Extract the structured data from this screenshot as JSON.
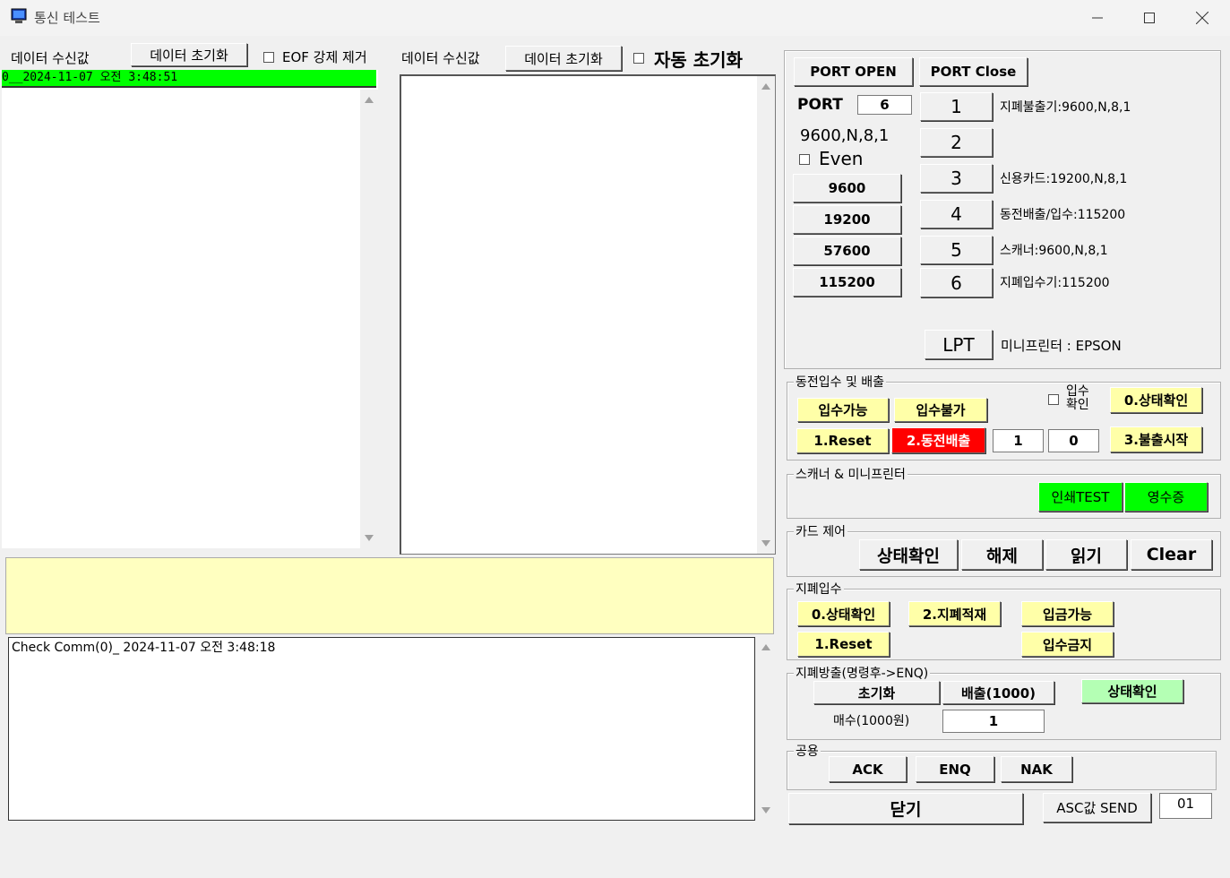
{
  "window": {
    "title": "통신 테스트",
    "minimize_icon": "minimize-icon",
    "maximize_icon": "maximize-icon",
    "close_icon": "close-icon"
  },
  "left_panel": {
    "label": "데이터 수신값",
    "reset_button": "데이터 초기화",
    "eof_label": "EOF 강제 제거",
    "eof_checked": false,
    "selected_item": "0__2024-11-07 오전 3:48:51"
  },
  "middle_panel": {
    "label": "데이터 수신값",
    "reset_button": "데이터 초기화",
    "auto_reset_label": "자동 초기화",
    "auto_reset_checked": false
  },
  "log_box": {
    "line": "Check Comm(0)_ 2024-11-07 오전 3:48:18"
  },
  "port": {
    "open_button": "PORT OPEN",
    "close_button": "PORT Close",
    "port_label": "PORT",
    "port_value": "6",
    "settings": "9600,N,8,1",
    "even_label": "Even",
    "even_checked": false,
    "baud_buttons": [
      "9600",
      "19200",
      "57600",
      "115200"
    ],
    "port_buttons": [
      "1",
      "2",
      "3",
      "4",
      "5",
      "6"
    ],
    "port_descriptions": [
      "지폐불출기:9600,N,8,1",
      "",
      "신용카드:19200,N,8,1",
      "동전배출/입수:115200",
      "스캐너:9600,N,8,1",
      "지폐입수기:115200"
    ],
    "lpt_button": "LPT",
    "lpt_description": "미니프린터 : EPSON"
  },
  "coin": {
    "title": "동전입수 및 배출",
    "accept_button": "입수가능",
    "reject_button": "입수불가",
    "confirm_label": "입수\n확인",
    "confirm_checked": false,
    "status_button": "0.상태확인",
    "reset_button": "1.Reset",
    "dispense_button": "2.동전배출",
    "value1": "1",
    "value2": "0",
    "start_button": "3.불출시작"
  },
  "scanner": {
    "title": "스캐너 & 미니프린터",
    "print_test_button": "인쇄TEST",
    "receipt_button": "영수증"
  },
  "card": {
    "title": "카드 제어",
    "status_button": "상태확인",
    "release_button": "해제",
    "read_button": "읽기",
    "clear_button": "Clear"
  },
  "bill_in": {
    "title": "지폐입수",
    "status_button": "0.상태확인",
    "stack_button": "2.지폐적재",
    "enable_button": "입금가능",
    "reset_button": "1.Reset",
    "disable_button": "입수금지"
  },
  "bill_out": {
    "title": "지폐방출(명령후->ENQ)",
    "init_button": "초기화",
    "dispense_button": "배출(1000)",
    "status_button": "상태확인",
    "count_label": "매수(1000원)",
    "count_value": "1"
  },
  "common": {
    "title": "공용",
    "ack_button": "ACK",
    "enq_button": "ENQ",
    "nak_button": "NAK"
  },
  "close_button": "닫기",
  "asc_send_button": "ASC값 SEND",
  "asc_value": "01",
  "colors": {
    "selected_row": "#00ff00",
    "yellow_panel": "#ffffc0",
    "yellow_button": "#ffffa8",
    "red_button": "#ff0000",
    "green_button": "#00ff00"
  }
}
